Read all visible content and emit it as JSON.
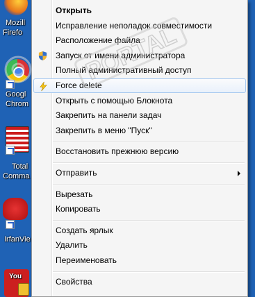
{
  "desktop": {
    "icons": [
      {
        "label_line1": "Mozill",
        "label_line2": "Firefo",
        "color": "#e8771c"
      },
      {
        "label_line1": "Googl",
        "label_line2": "Chrom",
        "color": "#3b9d3b"
      },
      {
        "label_line1": "Total",
        "label_line2": "Comma",
        "color": "#cc1b1b"
      },
      {
        "label_line1": "IrfanVie",
        "label_line2": "",
        "color": "#d42020"
      },
      {
        "label_line1": "You",
        "label_line2": "",
        "color": "#cc1f1f"
      }
    ]
  },
  "menu": {
    "groups": [
      [
        {
          "label": "Открыть",
          "bold": true
        },
        {
          "label": "Исправление неполадок совместимости"
        },
        {
          "label": "Расположение файла"
        },
        {
          "label": "Запуск от имени администратора",
          "icon": "uac-shield-icon"
        },
        {
          "label": "Полный административный доступ"
        },
        {
          "label": "Force delete",
          "icon": "lightning-icon",
          "hover": true
        },
        {
          "label": "Открыть с помощью Блокнота"
        },
        {
          "label": "Закрепить на панели задач"
        },
        {
          "label": "Закрепить в меню \"Пуск\""
        }
      ],
      [
        {
          "label": "Восстановить прежнюю версию"
        }
      ],
      [
        {
          "label": "Отправить",
          "submenu": true
        }
      ],
      [
        {
          "label": "Вырезать"
        },
        {
          "label": "Копировать"
        }
      ],
      [
        {
          "label": "Создать ярлык"
        },
        {
          "label": "Удалить"
        },
        {
          "label": "Переименовать"
        }
      ],
      [
        {
          "label": "Свойства"
        }
      ]
    ]
  },
  "watermark": {
    "text": "PORTAL"
  }
}
